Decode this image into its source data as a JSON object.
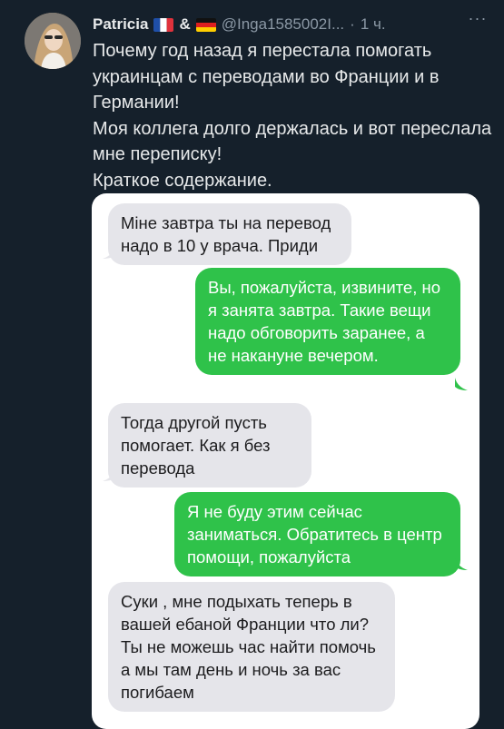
{
  "author": {
    "name": "Patricia",
    "flag_1": "france-flag-icon",
    "connector": "&",
    "flag_2": "germany-flag-icon",
    "handle": "@Inga1585002I...",
    "separator": "·",
    "time": "1 ч.",
    "more_label": "···"
  },
  "tweet": {
    "lines": [
      "Почему год назад я перестала помогать украинцам с переводами во Франции и в Германии!",
      "Моя коллега долго держалась и вот переслала мне переписку!",
      "Краткое содержание."
    ]
  },
  "chat": {
    "messages": [
      {
        "side": "incoming",
        "text": "Міне завтра ты на перевод надо в 10 у врача. Приди"
      },
      {
        "side": "outgoing",
        "text": "Вы, пожалуйста, извините, но я занята завтра. Такие вещи надо обговорить заранее, а не накануне вечером."
      },
      {
        "side": "incoming",
        "text": "Тогда другой пусть помогает. Как я без перевода"
      },
      {
        "side": "outgoing",
        "text": "Я не буду этим сейчас заниматься. Обратитесь в центр помощи, пожалуйста"
      },
      {
        "side": "incoming",
        "text": "Суки , мне подыхать теперь в вашей ебаной Франции что ли? Ты не можешь час найти помочь а мы там день и ночь за вас погибаем"
      }
    ]
  },
  "colors": {
    "background": "#15202b",
    "incoming_bubble": "#e5e5ea",
    "outgoing_bubble": "#2fc24a"
  }
}
